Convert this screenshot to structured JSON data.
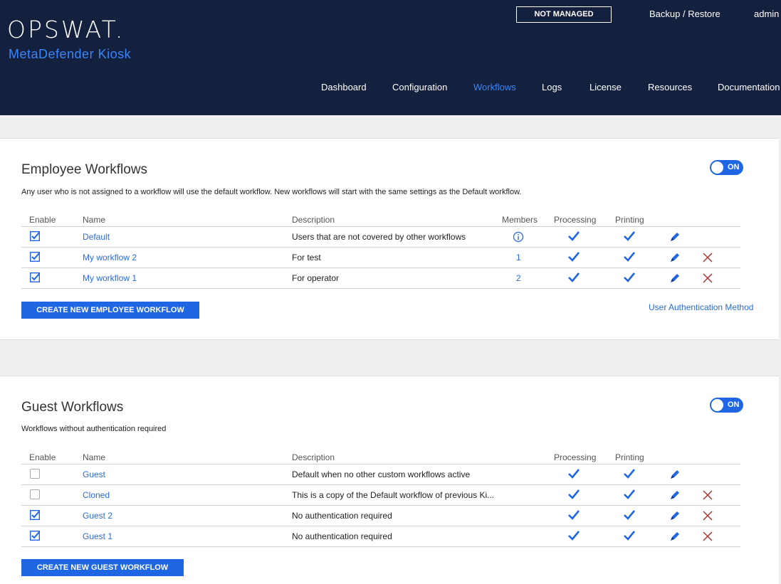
{
  "header": {
    "logo_text": "OPSWAT.",
    "product": "MetaDefender Kiosk",
    "status_badge": "NOT MANAGED",
    "backup_restore": "Backup / Restore",
    "user": "admin",
    "nav": [
      "Dashboard",
      "Configuration",
      "Workflows",
      "Logs",
      "License",
      "Resources",
      "Documentation"
    ],
    "active_nav": "Workflows"
  },
  "employee": {
    "title": "Employee Workflows",
    "toggle": "ON",
    "description": "Any user who is not assigned to a workflow will use the default workflow. New workflows will start with the same settings as the Default workflow.",
    "columns": {
      "enable": "Enable",
      "name": "Name",
      "description": "Description",
      "members": "Members",
      "processing": "Processing",
      "printing": "Printing"
    },
    "rows": [
      {
        "enabled": true,
        "name": "Default",
        "description": "Users that are not covered by other workflows",
        "members": "info-icon",
        "processing": true,
        "printing": true,
        "deletable": false
      },
      {
        "enabled": true,
        "name": "My workflow 2",
        "description": "For test",
        "members": "1",
        "processing": true,
        "printing": true,
        "deletable": true
      },
      {
        "enabled": true,
        "name": "My workflow 1",
        "description": "For operator",
        "members": "2",
        "processing": true,
        "printing": true,
        "deletable": true
      }
    ],
    "create_button": "CREATE NEW EMPLOYEE WORKFLOW",
    "auth_link": "User Authentication Method"
  },
  "guest": {
    "title": "Guest Workflows",
    "toggle": "ON",
    "description": "Workflows without authentication required",
    "columns": {
      "enable": "Enable",
      "name": "Name",
      "description": "Description",
      "processing": "Processing",
      "printing": "Printing"
    },
    "rows": [
      {
        "enabled": false,
        "name": "Guest",
        "description": "Default when no other custom workflows active",
        "processing": true,
        "printing": true,
        "deletable": false
      },
      {
        "enabled": false,
        "name": "Cloned",
        "description": "This is a copy of the Default workflow of previous Ki...",
        "processing": true,
        "printing": true,
        "deletable": true
      },
      {
        "enabled": true,
        "name": "Guest 2",
        "description": "No authentication required",
        "processing": true,
        "printing": true,
        "deletable": true
      },
      {
        "enabled": true,
        "name": "Guest 1",
        "description": "No authentication required",
        "processing": true,
        "printing": true,
        "deletable": true
      }
    ],
    "create_button": "CREATE NEW GUEST WORKFLOW"
  },
  "colors": {
    "navy": "#14213e",
    "accent": "#1f66e5",
    "link": "#2b6bd8",
    "delete": "#a33"
  }
}
